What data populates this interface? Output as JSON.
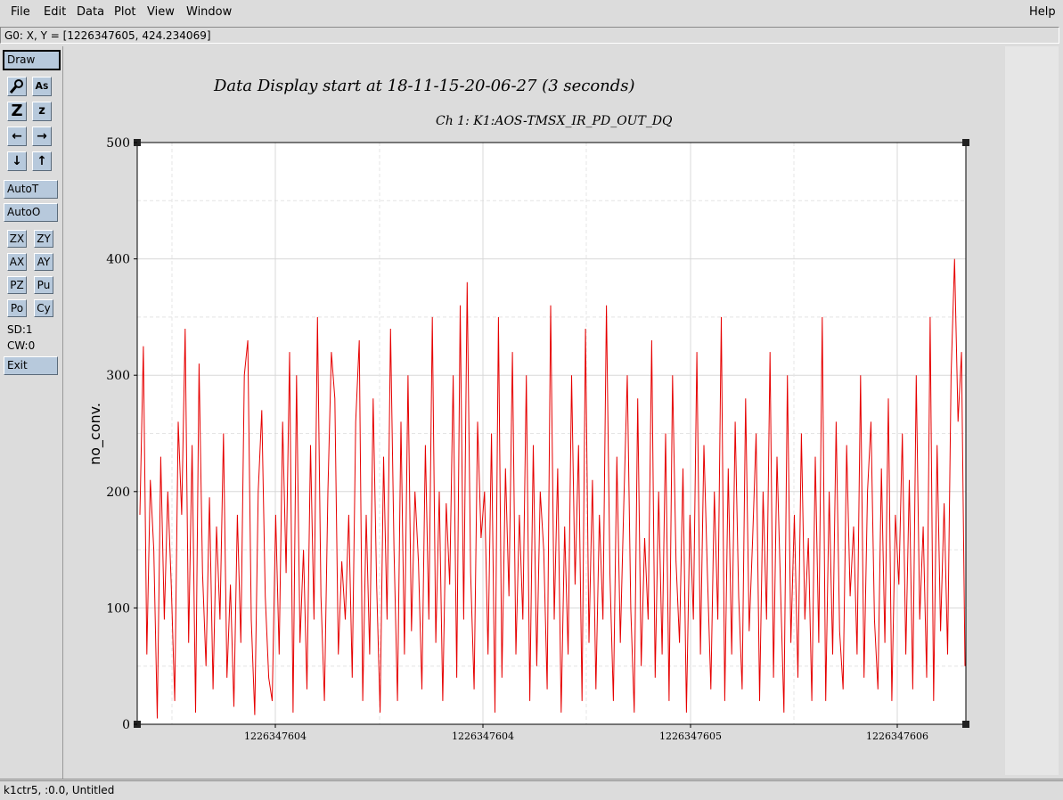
{
  "menu": {
    "file": "File",
    "edit": "Edit",
    "data": "Data",
    "plot": "Plot",
    "view": "View",
    "window": "Window",
    "help": "Help"
  },
  "coord_readout": "G0: X, Y = [1226347605, 424.234069]",
  "toolbar": {
    "draw": "Draw",
    "autot": "AutoT",
    "autoo": "AutoO",
    "zx": "ZX",
    "zy": "ZY",
    "ax": "AX",
    "ay": "AY",
    "pz": "PZ",
    "pu": "Pu",
    "po": "Po",
    "cy": "Cy",
    "sd": "SD:1",
    "cw": "CW:0",
    "exit": "Exit",
    "icons": [
      "magnify-icon",
      "text-as-icon",
      "zoom-z-large-icon",
      "zoom-z-small-icon",
      "arrow-left-icon",
      "arrow-right-icon",
      "arrow-down-icon",
      "arrow-up-icon"
    ]
  },
  "status": "k1ctr5, :0.0, Untitled",
  "colors": {
    "trace": "#e60000",
    "button": "#b7c9dc",
    "background": "#dcdcdc"
  },
  "chart_data": {
    "type": "line",
    "title": "Data Display start at 18-11-15-20-06-27 (3 seconds)",
    "subtitle": "Ch 1: K1:AOS-TMSX_IR_PD_OUT_DQ",
    "xlabel": "",
    "ylabel": "no_conv.",
    "ylim": [
      0,
      500
    ],
    "yticks": [
      "0",
      "100",
      "200",
      "300",
      "400",
      "500"
    ],
    "xticks": [
      "1226347604",
      "1226347604",
      "1226347605",
      "1226347606"
    ],
    "grid": true,
    "series": [
      {
        "values": [
          180,
          325,
          60,
          210,
          150,
          5,
          230,
          90,
          200,
          120,
          20,
          260,
          180,
          340,
          70,
          240,
          10,
          310,
          130,
          50,
          195,
          30,
          170,
          90,
          250,
          40,
          120,
          15,
          180,
          70,
          300,
          330,
          90,
          8,
          200,
          270,
          110,
          40,
          20,
          180,
          60,
          260,
          130,
          320,
          10,
          300,
          70,
          150,
          30,
          240,
          90,
          350,
          110,
          20,
          200,
          320,
          280,
          60,
          140,
          90,
          180,
          40,
          260,
          330,
          20,
          180,
          60,
          280,
          120,
          10,
          230,
          90,
          340,
          150,
          20,
          260,
          60,
          300,
          80,
          200,
          140,
          30,
          240,
          90,
          350,
          70,
          200,
          20,
          190,
          120,
          300,
          40,
          360,
          90,
          380,
          130,
          30,
          260,
          160,
          200,
          60,
          250,
          10,
          350,
          40,
          220,
          110,
          320,
          60,
          180,
          90,
          300,
          20,
          240,
          50,
          200,
          150,
          30,
          360,
          90,
          220,
          10,
          170,
          60,
          300,
          120,
          240,
          20,
          340,
          70,
          210,
          30,
          180,
          90,
          360,
          130,
          20,
          230,
          70,
          190,
          300,
          100,
          10,
          280,
          50,
          160,
          90,
          330,
          40,
          200,
          60,
          250,
          20,
          300,
          140,
          70,
          220,
          10,
          180,
          90,
          320,
          60,
          240,
          130,
          30,
          200,
          90,
          350,
          20,
          220,
          60,
          260,
          110,
          30,
          280,
          80,
          160,
          250,
          20,
          200,
          90,
          320,
          40,
          230,
          120,
          10,
          300,
          70,
          180,
          40,
          250,
          90,
          160,
          20,
          230,
          70,
          350,
          20,
          200,
          60,
          260,
          80,
          30,
          240,
          110,
          170,
          60,
          300,
          40,
          200,
          260,
          90,
          30,
          220,
          70,
          280,
          20,
          180,
          120,
          250,
          60,
          210,
          30,
          300,
          90,
          170,
          40,
          350,
          20,
          240,
          80,
          190,
          60,
          300,
          400,
          260,
          320,
          50
        ]
      }
    ]
  }
}
